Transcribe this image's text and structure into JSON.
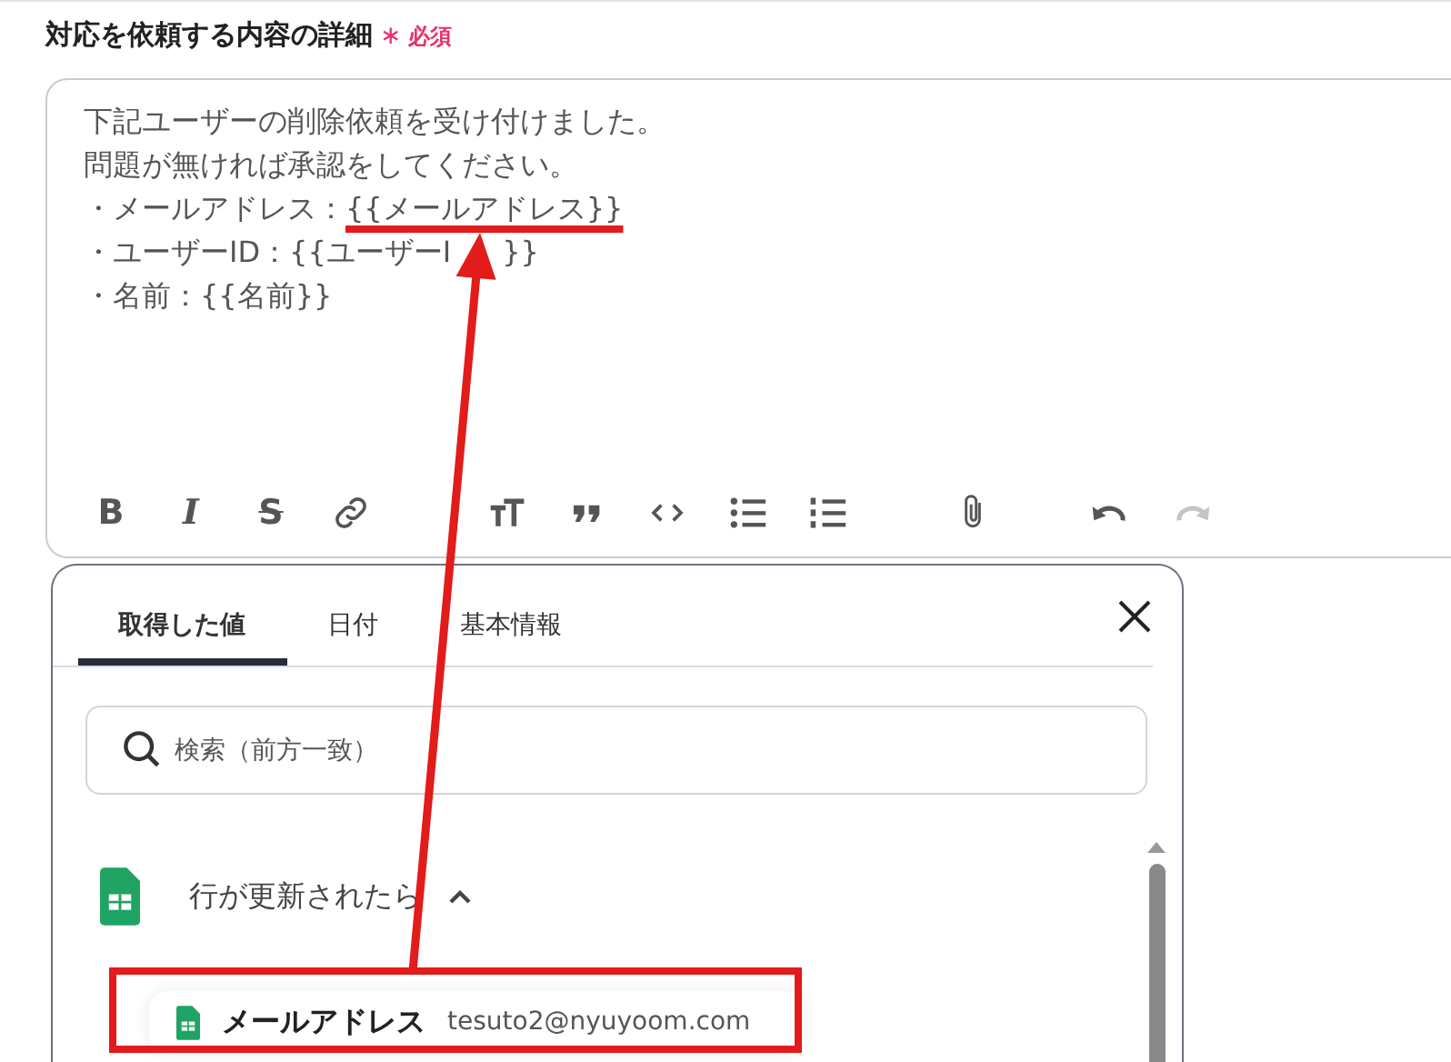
{
  "field": {
    "label": "対応を依頼する内容の詳細",
    "required_mark": "∗",
    "required": "必須"
  },
  "editor": {
    "lines": [
      {
        "text": "下記ユーザーの削除依頼を受け付けました。"
      },
      {
        "text": "問題が無ければ承認をしてください。"
      },
      {
        "text": "・メールアドレス：",
        "underlined": "{{メールアドレス}}"
      },
      {
        "text": "・ユーザーID：{{ユーザーI",
        "tail": "}}"
      },
      {
        "text": "・名前：{{名前}}"
      }
    ]
  },
  "toolbar": [
    {
      "kind": "bold",
      "label": "B",
      "disabled": false
    },
    {
      "kind": "italic",
      "label": "I",
      "disabled": false
    },
    {
      "kind": "strike",
      "label": "S",
      "disabled": false
    },
    {
      "kind": "link",
      "disabled": false
    },
    {
      "kind": "heading",
      "disabled": false
    },
    {
      "kind": "quote",
      "disabled": false
    },
    {
      "kind": "code",
      "disabled": false
    },
    {
      "kind": "bullets",
      "disabled": false
    },
    {
      "kind": "numbers",
      "disabled": false
    },
    {
      "kind": "attach",
      "disabled": false
    },
    {
      "kind": "undo",
      "disabled": false
    },
    {
      "kind": "redo",
      "disabled": true
    }
  ],
  "panel": {
    "tabs": [
      {
        "label": "取得した値",
        "selected": true
      },
      {
        "label": "日付",
        "selected": false
      },
      {
        "label": "基本情報",
        "selected": false
      }
    ],
    "search": {
      "placeholder": "検索（前方一致）"
    },
    "group": {
      "title": "行が更新されたら",
      "expanded": true,
      "items": [
        {
          "label": "メールアドレス",
          "value": "tesuto2@nyuyoom.com"
        }
      ]
    }
  }
}
